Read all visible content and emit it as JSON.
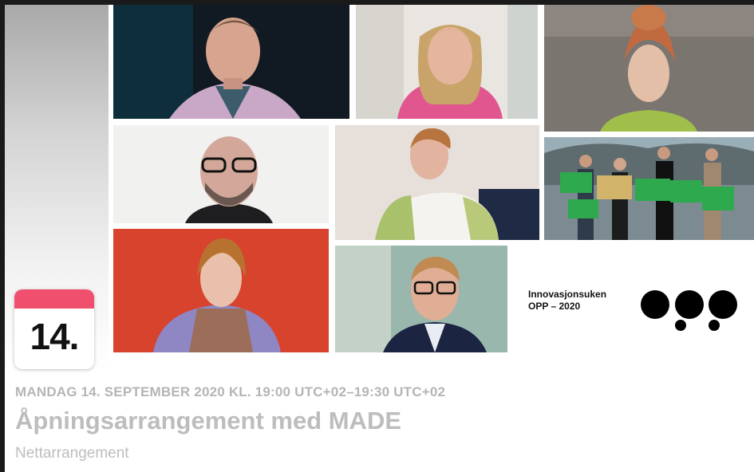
{
  "event": {
    "datetime": "MANDAG 14. SEPTEMBER 2020 KL. 19:00 UTC+02–19:30 UTC+02",
    "title": "Åpningsarrangement med MADE",
    "kind": "Nettarrangement"
  },
  "date_badge": {
    "day": "14.",
    "accent_color": "#f0506e"
  },
  "cover": {
    "organizer_line1": "Innovasjonsuken",
    "organizer_line2": "OPP – 2020",
    "logo_icon": "opp-logo-icon",
    "photos": [
      "portrait-young-man-suit",
      "portrait-blonde-woman-pink-top",
      "portrait-woman-red-hair-updo",
      "portrait-bald-man-glasses",
      "portrait-young-man-reclining",
      "group-photo-with-award-signs",
      "portrait-woman-scarf-red-background",
      "portrait-man-glasses-suit"
    ]
  },
  "colors": {
    "background_frame": "#1a1a1a",
    "card": "#ffffff",
    "muted_text": "#b5b5b5"
  }
}
